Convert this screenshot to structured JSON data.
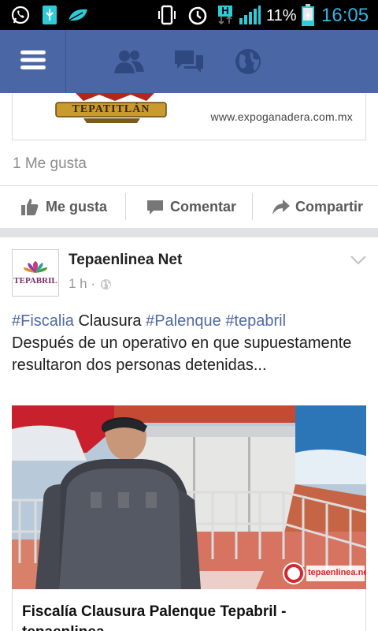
{
  "status_bar": {
    "battery_percent": "11%",
    "time": "16:05",
    "network_label": "H",
    "icons": [
      "whatsapp-icon",
      "usb-icon",
      "leaf-icon",
      "vibrate-icon",
      "alarm-icon",
      "network-h-icon",
      "signal-icon",
      "battery-charging-icon"
    ]
  },
  "header": {
    "icons": [
      "menu-icon",
      "friend-requests-icon",
      "messages-icon",
      "notifications-globe-icon"
    ],
    "color": "#4a66a5"
  },
  "ad": {
    "logo_text": "TEPATITLÁN",
    "url": "www.expoganadera.com.mx"
  },
  "likes_count": "1 Me gusta",
  "actions": {
    "like": "Me gusta",
    "comment": "Comentar",
    "share": "Compartir"
  },
  "post": {
    "page_name": "Tepaenlinea Net",
    "avatar_text": "TEPABRIL",
    "time": "1 h ·",
    "hashtag1": "#Fiscalia",
    "word1": "Clausura",
    "hashtag2": "#Palenque",
    "hashtag3": "#tepabril",
    "body": "Después de un operativo en que supuestamente resultaron dos personas detenidas...",
    "image_watermark": "tepaenlinea.net",
    "link_title": "Fiscalía Clausura Palenque Tepabril - tepaenlinea"
  }
}
